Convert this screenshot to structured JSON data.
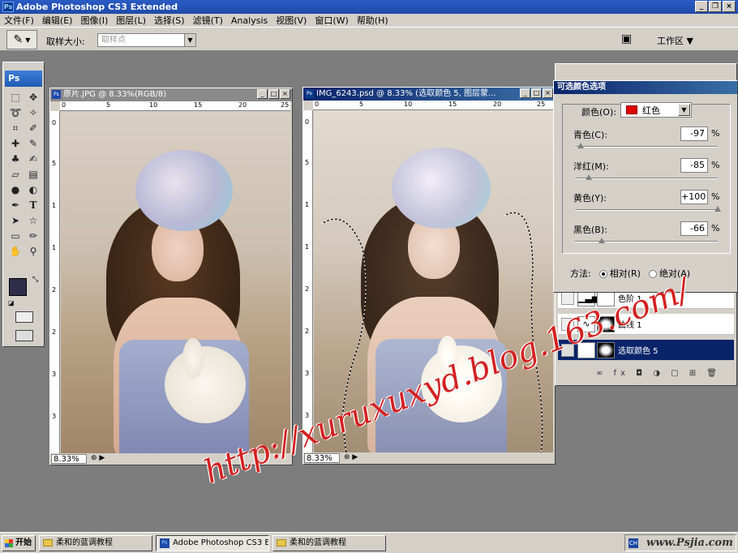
{
  "app": {
    "title": "Adobe Photoshop CS3 Extended"
  },
  "menu": [
    "文件(F)",
    "编辑(E)",
    "图像(I)",
    "图层(L)",
    "选择(S)",
    "滤镜(T)",
    "Analysis",
    "视图(V)",
    "窗口(W)",
    "帮助(H)"
  ],
  "options": {
    "sample_size_label": "取样大小:",
    "sample_size_value": "取样点",
    "workspace_label": "工作区"
  },
  "toolbox": {
    "logo": "Ps"
  },
  "doc1": {
    "title": "原片.JPG @ 8.33%(RGB/8)",
    "zoom": "8.33%",
    "ruler_h": [
      "0",
      "5",
      "10",
      "15",
      "20",
      "25"
    ],
    "ruler_v": [
      "0",
      "5",
      "1",
      "1",
      "2",
      "2",
      "3",
      "3"
    ]
  },
  "doc2": {
    "title": "IMG_6243.psd @ 8.33% (选取颜色 5, 图层蒙...",
    "zoom": "8.33%",
    "ruler_h": [
      "0",
      "5",
      "10",
      "15",
      "20",
      "25"
    ],
    "ruler_v": [
      "0",
      "5",
      "1",
      "1",
      "2",
      "2",
      "3",
      "3"
    ]
  },
  "layers_panel": {
    "layers": [
      {
        "name": "色阶 1",
        "selected": false
      },
      {
        "name": "曲线 1",
        "selected": false
      },
      {
        "name": "选取颜色 5",
        "selected": true
      }
    ]
  },
  "selective_color": {
    "title": "可选颜色选项",
    "color_label": "颜色(O):",
    "color_value": "红色",
    "swatch_color": "#e00000",
    "sliders": [
      {
        "label": "青色(C):",
        "value": "-97",
        "pct": "%",
        "level": -97
      },
      {
        "label": "洋红(M):",
        "value": "-85",
        "pct": "%",
        "level": -85
      },
      {
        "label": "黄色(Y):",
        "value": "+100",
        "pct": "%",
        "level": 100
      },
      {
        "label": "黑色(B):",
        "value": "-66",
        "pct": "%",
        "level": -66
      }
    ],
    "method_label": "方法:",
    "method_relative": "相对(R)",
    "method_absolute": "绝对(A)"
  },
  "taskbar": {
    "start": "开始",
    "items": [
      "柔和的蓝调教程",
      "Adobe Photoshop CS3 E...",
      "柔和的蓝调教程"
    ]
  },
  "watermark": {
    "url": "http://xuruxuxyd.blog.163.com/",
    "site": "www.Psjia.com"
  }
}
